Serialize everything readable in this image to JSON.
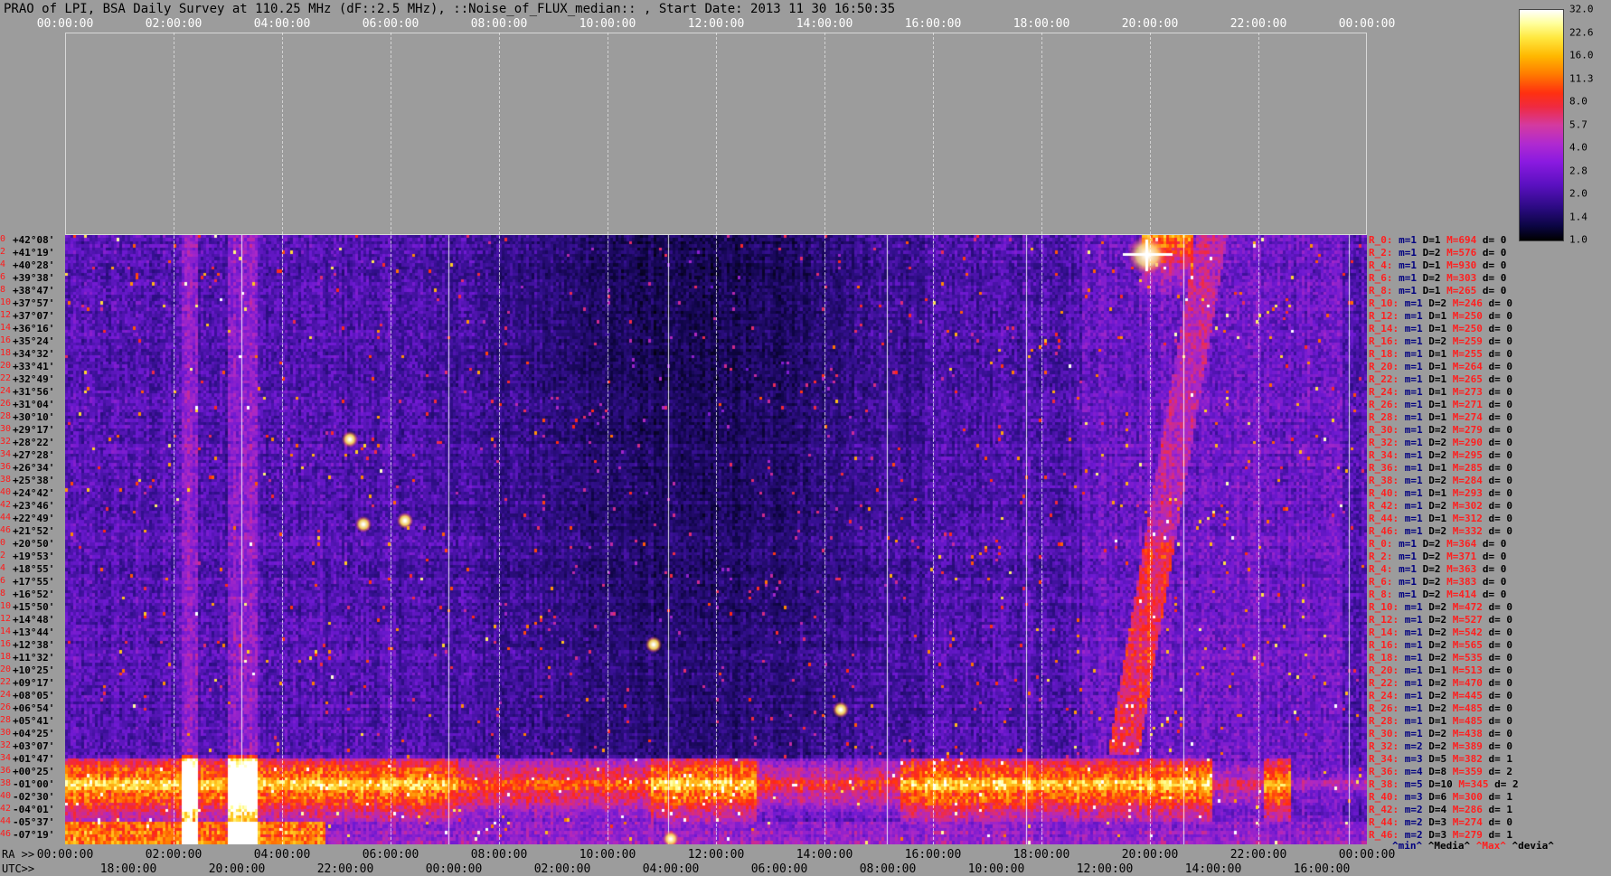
{
  "title": "PRAO of LPI, BSA Daily Survey at 110.25 MHz (dF::2.5 MHz), ::Noise_of_FLUX_median:: , Start Date: 2013 11 30 16:50:35",
  "top_ticks": [
    "00:00:00",
    "02:00:00",
    "04:00:00",
    "06:00:00",
    "08:00:00",
    "10:00:00",
    "12:00:00",
    "14:00:00",
    "16:00:00",
    "18:00:00",
    "20:00:00",
    "22:00:00",
    "00:00:00"
  ],
  "ra_label": "RA >>",
  "utc_label": "UTC>>",
  "ra_ticks": [
    "00:00:00",
    "02:00:00",
    "04:00:00",
    "06:00:00",
    "08:00:00",
    "10:00:00",
    "12:00:00",
    "14:00:00",
    "16:00:00",
    "18:00:00",
    "20:00:00",
    "22:00:00",
    "00:00:00"
  ],
  "utc_ticks": [
    "18:00:00",
    "20:00:00",
    "22:00:00",
    "00:00:00",
    "02:00:00",
    "04:00:00",
    "06:00:00",
    "08:00:00",
    "10:00:00",
    "12:00:00",
    "14:00:00",
    "16:00:00"
  ],
  "colorbar_labels": [
    "32.0",
    "22.6",
    "16.0",
    "11.3",
    "8.0",
    "5.7",
    "4.0",
    "2.8",
    "2.0",
    "1.4",
    "1.0"
  ],
  "declinations": [
    "+42°08'",
    "+41°19'",
    "+40°28'",
    "+39°38'",
    "+38°47'",
    "+37°57'",
    "+37°07'",
    "+36°16'",
    "+35°24'",
    "+34°32'",
    "+33°41'",
    "+32°49'",
    "+31°56'",
    "+31°04'",
    "+30°10'",
    "+29°17'",
    "+28°22'",
    "+27°28'",
    "+26°34'",
    "+25°38'",
    "+24°42'",
    "+23°46'",
    "+22°49'",
    "+21°52'",
    "+20°50'",
    "+19°53'",
    "+18°55'",
    "+17°55'",
    "+16°52'",
    "+15°50'",
    "+14°48'",
    "+13°44'",
    "+12°38'",
    "+11°32'",
    "+10°25'",
    "+09°17'",
    "+08°05'",
    "+06°54'",
    "+05°41'",
    "+04°25'",
    "+03°07'",
    "+01°47'",
    "+00°25'",
    "-01°00'",
    "-02°30'",
    "-04°01'",
    "-05°37'",
    "-07°19'"
  ],
  "row_numbers": [
    "0",
    "2",
    "4",
    "6",
    "8",
    "10",
    "12",
    "14",
    "16",
    "18",
    "20",
    "22",
    "24",
    "26",
    "28",
    "30",
    "32",
    "34",
    "36",
    "38",
    "40",
    "42",
    "44",
    "46",
    "0",
    "2",
    "4",
    "6",
    "8",
    "10",
    "12",
    "14",
    "16",
    "18",
    "20",
    "22",
    "24",
    "26",
    "28",
    "30",
    "32",
    "34",
    "36",
    "38",
    "40",
    "42",
    "44",
    "46"
  ],
  "stats": [
    [
      "R_0:",
      "m=1",
      "D=1",
      "M=694",
      "d= 0"
    ],
    [
      "R_2:",
      "m=1",
      "D=2",
      "M=576",
      "d= 0"
    ],
    [
      "R_4:",
      "m=1",
      "D=1",
      "M=930",
      "d= 0"
    ],
    [
      "R_6:",
      "m=1",
      "D=2",
      "M=303",
      "d= 0"
    ],
    [
      "R_8:",
      "m=1",
      "D=1",
      "M=265",
      "d= 0"
    ],
    [
      "R_10:",
      "m=1",
      "D=2",
      "M=246",
      "d= 0"
    ],
    [
      "R_12:",
      "m=1",
      "D=1",
      "M=250",
      "d= 0"
    ],
    [
      "R_14:",
      "m=1",
      "D=1",
      "M=250",
      "d= 0"
    ],
    [
      "R_16:",
      "m=1",
      "D=2",
      "M=259",
      "d= 0"
    ],
    [
      "R_18:",
      "m=1",
      "D=1",
      "M=255",
      "d= 0"
    ],
    [
      "R_20:",
      "m=1",
      "D=1",
      "M=264",
      "d= 0"
    ],
    [
      "R_22:",
      "m=1",
      "D=1",
      "M=265",
      "d= 0"
    ],
    [
      "R_24:",
      "m=1",
      "D=1",
      "M=273",
      "d= 0"
    ],
    [
      "R_26:",
      "m=1",
      "D=1",
      "M=271",
      "d= 0"
    ],
    [
      "R_28:",
      "m=1",
      "D=1",
      "M=274",
      "d= 0"
    ],
    [
      "R_30:",
      "m=1",
      "D=2",
      "M=279",
      "d= 0"
    ],
    [
      "R_32:",
      "m=1",
      "D=2",
      "M=290",
      "d= 0"
    ],
    [
      "R_34:",
      "m=1",
      "D=2",
      "M=295",
      "d= 0"
    ],
    [
      "R_36:",
      "m=1",
      "D=1",
      "M=285",
      "d= 0"
    ],
    [
      "R_38:",
      "m=1",
      "D=2",
      "M=284",
      "d= 0"
    ],
    [
      "R_40:",
      "m=1",
      "D=1",
      "M=293",
      "d= 0"
    ],
    [
      "R_42:",
      "m=1",
      "D=2",
      "M=302",
      "d= 0"
    ],
    [
      "R_44:",
      "m=1",
      "D=1",
      "M=312",
      "d= 0"
    ],
    [
      "R_46:",
      "m=1",
      "D=2",
      "M=332",
      "d= 0"
    ],
    [
      "R_0:",
      "m=1",
      "D=2",
      "M=364",
      "d= 0"
    ],
    [
      "R_2:",
      "m=1",
      "D=2",
      "M=371",
      "d= 0"
    ],
    [
      "R_4:",
      "m=1",
      "D=2",
      "M=363",
      "d= 0"
    ],
    [
      "R_6:",
      "m=1",
      "D=2",
      "M=383",
      "d= 0"
    ],
    [
      "R_8:",
      "m=1",
      "D=2",
      "M=414",
      "d= 0"
    ],
    [
      "R_10:",
      "m=1",
      "D=2",
      "M=472",
      "d= 0"
    ],
    [
      "R_12:",
      "m=1",
      "D=2",
      "M=527",
      "d= 0"
    ],
    [
      "R_14:",
      "m=1",
      "D=2",
      "M=542",
      "d= 0"
    ],
    [
      "R_16:",
      "m=1",
      "D=2",
      "M=565",
      "d= 0"
    ],
    [
      "R_18:",
      "m=1",
      "D=2",
      "M=535",
      "d= 0"
    ],
    [
      "R_20:",
      "m=1",
      "D=1",
      "M=513",
      "d= 0"
    ],
    [
      "R_22:",
      "m=1",
      "D=2",
      "M=470",
      "d= 0"
    ],
    [
      "R_24:",
      "m=1",
      "D=2",
      "M=445",
      "d= 0"
    ],
    [
      "R_26:",
      "m=1",
      "D=2",
      "M=485",
      "d= 0"
    ],
    [
      "R_28:",
      "m=1",
      "D=1",
      "M=485",
      "d= 0"
    ],
    [
      "R_30:",
      "m=1",
      "D=2",
      "M=438",
      "d= 0"
    ],
    [
      "R_32:",
      "m=2",
      "D=2",
      "M=389",
      "d= 0"
    ],
    [
      "R_34:",
      "m=3",
      "D=5",
      "M=382",
      "d= 1"
    ],
    [
      "R_36:",
      "m=4",
      "D=8",
      "M=359",
      "d= 2"
    ],
    [
      "R_38:",
      "m=5",
      "D=10",
      "M=345",
      "d= 2"
    ],
    [
      "R_40:",
      "m=3",
      "D=6",
      "M=300",
      "d= 1"
    ],
    [
      "R_42:",
      "m=2",
      "D=4",
      "M=286",
      "d= 1"
    ],
    [
      "R_44:",
      "m=2",
      "D=3",
      "M=274",
      "d= 0"
    ],
    [
      "R_46:",
      "m=2",
      "D=3",
      "M=279",
      "d= 1"
    ]
  ],
  "legend": {
    "min": "^min^",
    "media": "^Media^",
    "max": "^Max^",
    "devia": "^devia^"
  },
  "colors": {
    "background": "#9c9c9c",
    "label_red": "#ff2020",
    "label_navy": "#000080"
  }
}
